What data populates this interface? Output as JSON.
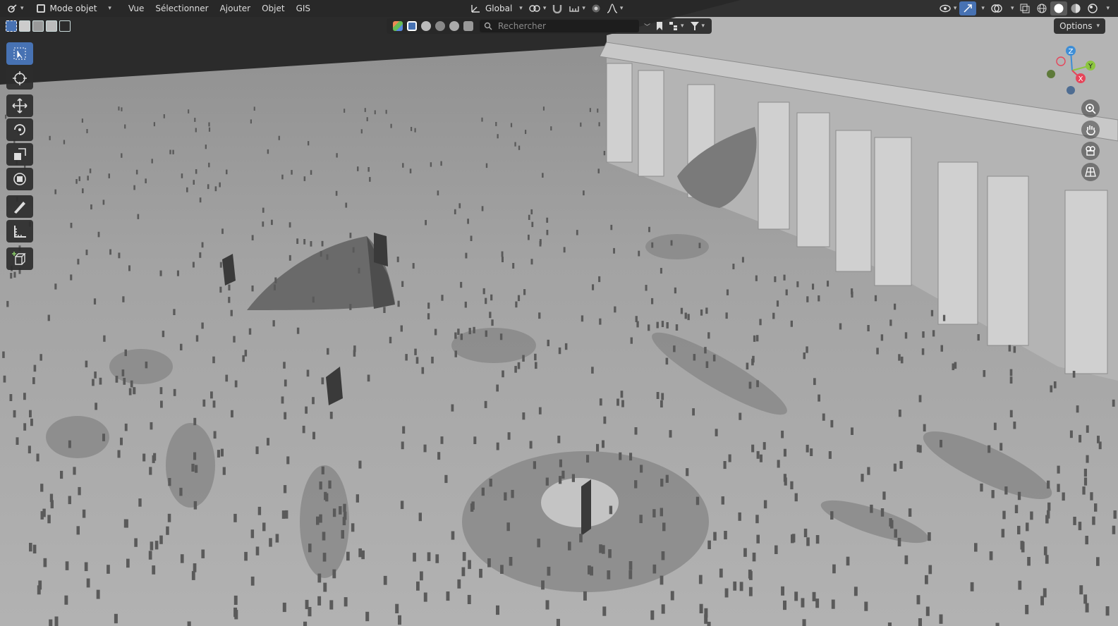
{
  "header": {
    "editor_icon": "viewport-editor-icon",
    "mode": "Mode objet",
    "menus": [
      "Vue",
      "Sélectionner",
      "Ajouter",
      "Objet",
      "GIS"
    ],
    "transform_orientation": "Global"
  },
  "filterbar": {
    "search_placeholder": "Rechercher"
  },
  "options_label": "Options",
  "left_tools": [
    "select-box-tool-icon",
    "cursor-tool-icon",
    "move-tool-icon",
    "rotate-tool-icon",
    "scale-tool-icon",
    "transform-tool-icon",
    "annotate-tool-icon",
    "measure-tool-icon",
    "add-cube-tool-icon"
  ],
  "gizmo_axes": {
    "z": "Z",
    "y": "Y",
    "x": "X"
  },
  "nav_buttons": [
    "zoom-icon",
    "pan-hand-icon",
    "camera-icon",
    "grid-perspective-icon"
  ],
  "colors": {
    "accent": "#4772b3",
    "header_bg": "#282828",
    "ground": "#a8a8a8",
    "axis_x": "#e6455a",
    "axis_y": "#8cc63f",
    "axis_z": "#3e8ed6"
  }
}
